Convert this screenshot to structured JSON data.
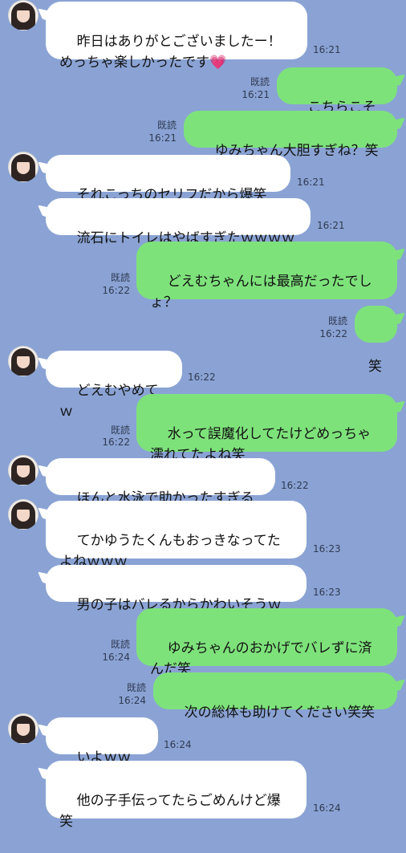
{
  "colors": {
    "background": "#8aa3d4",
    "incoming_bubble": "#ffffff",
    "outgoing_bubble": "#7ee27b",
    "heart_emoji": "#ee5aa6"
  },
  "messages": [
    {
      "side": "in",
      "text": "昨日はありがとございましたー！\nめっちゃ楽しかったです",
      "emoji": "💗",
      "time": "16:21"
    },
    {
      "side": "out",
      "text": "こちらこそー",
      "read": "既読",
      "time": "16:21"
    },
    {
      "side": "out",
      "text": "ゆみちゃん大胆すぎね？笑",
      "read": "既読",
      "time": "16:21"
    },
    {
      "side": "in",
      "text": "それこっちのセリフだから爆笑",
      "time": "16:21"
    },
    {
      "side": "in",
      "text": "流石にトイレはやばすぎたｗｗｗｗ",
      "time": "16:21"
    },
    {
      "side": "out",
      "text": "どえむちゃんには最高だったでし\nょ？",
      "read": "既読",
      "time": "16:22"
    },
    {
      "side": "out",
      "text": "笑",
      "read": "既読",
      "time": "16:22"
    },
    {
      "side": "in",
      "text": "どえむやめてｗ",
      "time": "16:22"
    },
    {
      "side": "out",
      "text": "水って誤魔化してたけどめっちゃ\n濡れてたよね笑",
      "read": "既読",
      "time": "16:22"
    },
    {
      "side": "in",
      "text": "ほんと水泳で助かったすぎる",
      "time": "16:22"
    },
    {
      "side": "in",
      "text": "てかゆうたくんもおっきなってた\nよねｗｗｗ",
      "time": "16:23"
    },
    {
      "side": "in",
      "text": "男の子はバレるからかわいそうｗ",
      "time": "16:23"
    },
    {
      "side": "out",
      "text": "ゆみちゃんのおかげでバレずに済\nんだ笑",
      "read": "既読",
      "time": "16:24"
    },
    {
      "side": "out",
      "text": "次の総体も助けてください笑笑",
      "read": "既読",
      "time": "16:24"
    },
    {
      "side": "in",
      "text": "いよｗｗｗｗ",
      "time": "16:24"
    },
    {
      "side": "in",
      "text": "他の子手伝ってたらごめんけど爆\n笑",
      "time": "16:24"
    }
  ]
}
